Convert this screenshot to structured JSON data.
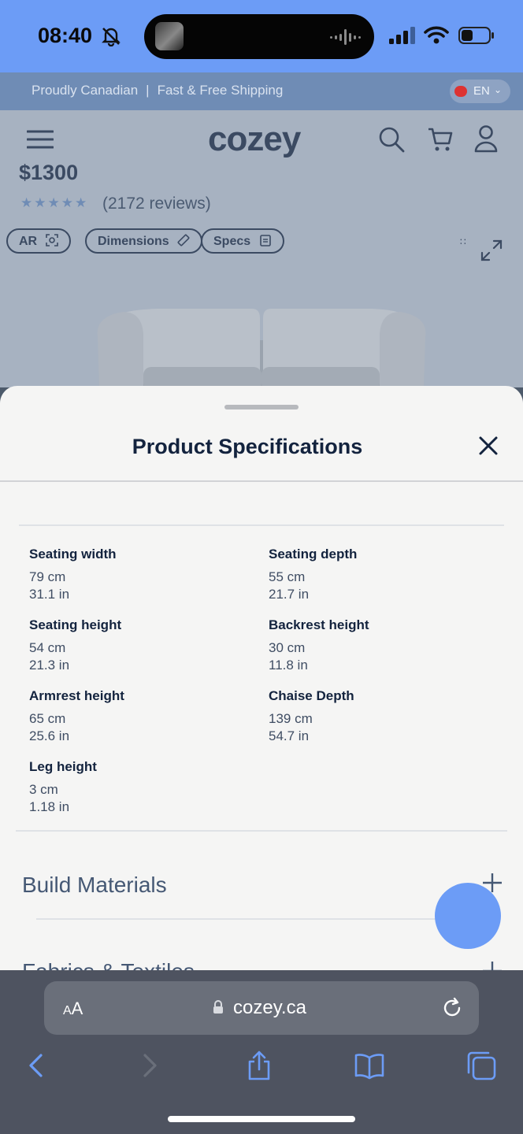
{
  "status_bar": {
    "time": "08:40"
  },
  "promo": {
    "left": "Proudly Canadian",
    "separator": "|",
    "right": "Fast & Free Shipping",
    "language": "EN"
  },
  "header": {
    "logo": "cozey"
  },
  "product": {
    "price": "$1300",
    "stars": "★★★★★",
    "reviews": "(2172 reviews)",
    "chips": {
      "ar": "AR",
      "dimensions": "Dimensions",
      "specs": "Specs"
    }
  },
  "sheet": {
    "title": "Product Specifications",
    "specs": [
      {
        "label": "Seating width",
        "cm": "79 cm",
        "in": "31.1 in"
      },
      {
        "label": "Seating depth",
        "cm": "55 cm",
        "in": "21.7 in"
      },
      {
        "label": "Seating height",
        "cm": "54 cm",
        "in": "21.3 in"
      },
      {
        "label": "Backrest height",
        "cm": "30 cm",
        "in": "11.8 in"
      },
      {
        "label": "Armrest height",
        "cm": "65 cm",
        "in": "25.6 in"
      },
      {
        "label": "Chaise Depth",
        "cm": "139 cm",
        "in": "54.7 in"
      },
      {
        "label": "Leg height",
        "cm": "3 cm",
        "in": "1.18 in"
      }
    ],
    "sections": {
      "build": "Build Materials",
      "next": "Fabrics & Textiles"
    }
  },
  "browser": {
    "aa_small": "A",
    "aa_big": "A",
    "url": "cozey.ca"
  },
  "colors": {
    "accent": "#6c9cf6",
    "navy": "#13233e",
    "sheet_bg": "#f5f5f4"
  }
}
